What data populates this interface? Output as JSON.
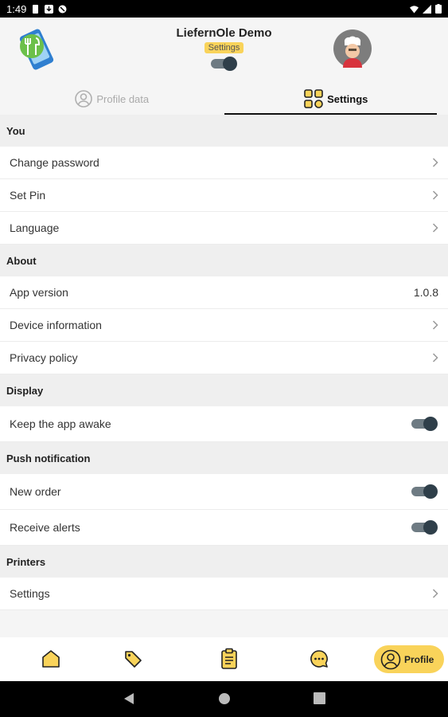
{
  "status_bar": {
    "time": "1:49"
  },
  "header": {
    "app_title": "LiefernOle Demo",
    "badge": "Settings",
    "toggle_on": true
  },
  "tabs": [
    {
      "label": "Profile data",
      "active": false
    },
    {
      "label": "Settings",
      "active": true
    }
  ],
  "sections": {
    "you": {
      "title": "You",
      "items": [
        "Change password",
        "Set Pin",
        "Language"
      ]
    },
    "about": {
      "title": "About",
      "app_version_label": "App version",
      "app_version_value": "1.0.8",
      "items": [
        "Device information",
        "Privacy policy"
      ]
    },
    "display": {
      "title": "Display",
      "keep_awake_label": "Keep the app awake",
      "keep_awake_on": true
    },
    "push": {
      "title": "Push notification",
      "new_order_label": "New order",
      "new_order_on": true,
      "alerts_label": "Receive alerts",
      "alerts_on": true
    },
    "printers": {
      "title": "Printers",
      "settings_label": "Settings"
    }
  },
  "bottom_nav": {
    "items": [
      "home-icon",
      "tag-icon",
      "clipboard-icon",
      "chat-icon"
    ],
    "profile_label": "Profile"
  },
  "colors": {
    "accent": "#f9d35a",
    "toggle_track": "#6e7b83",
    "toggle_knob": "#2f3f4a"
  }
}
